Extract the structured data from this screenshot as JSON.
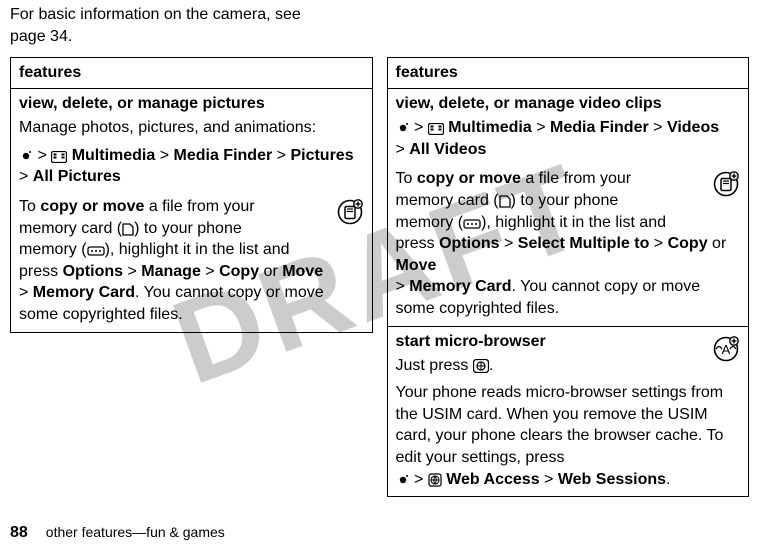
{
  "watermark": "DRAFT",
  "intro": {
    "line1": "For basic information on the camera, see",
    "line2": "page 34."
  },
  "left": {
    "header": "features",
    "row1": {
      "title": "view, delete, or manage pictures",
      "lead": "Manage photos, pictures, and animations:",
      "path1_app": "Multimedia",
      "path1_sep1": ">",
      "path1_b": "Media Finder",
      "path1_sep2": ">",
      "path1_c": "Pictures",
      "path1_sep3": ">",
      "path1_d": "All Pictures",
      "copy_lead_a": "To ",
      "copy_bold": "copy or move",
      "copy_lead_b": " a file from your",
      "copy_line2a": "memory card (",
      "copy_line2b": ") to your phone",
      "copy_line3a": "memory (",
      "copy_line3b": "), highlight it in the list and",
      "copy_line4a": "press ",
      "opt": "Options",
      "sep": ">",
      "manage": "Manage",
      "copy": "Copy",
      "or": " or ",
      "move": "Move",
      "memcard": "Memory Card",
      "tail": ". You cannot copy or move some copyrighted files."
    }
  },
  "right": {
    "header": "features",
    "row1": {
      "title": "view, delete, or manage video clips",
      "path_app": "Multimedia",
      "path_sep1": ">",
      "path_b": "Media Finder",
      "path_sep2": ">",
      "path_c": "Videos",
      "path_sep3": ">",
      "path_d": "All Videos",
      "copy_lead_a": "To ",
      "copy_bold": "copy or move",
      "copy_lead_b": " a file from your",
      "copy_line2a": "memory card (",
      "copy_line2b": ") to your phone",
      "copy_line3a": "memory (",
      "copy_line3b": "), highlight it in the list and",
      "copy_line4a": "press ",
      "opt": "Options",
      "sep": ">",
      "selmult": "Select Multiple to",
      "copy": "Copy",
      "or": " or ",
      "move": "Move",
      "memcard": "Memory Card",
      "tail": ". You cannot copy or move some copyrighted files."
    },
    "row2": {
      "title": "start micro-browser",
      "just_press": "Just press ",
      "period": ".",
      "para2": "Your phone reads micro-browser settings from the USIM card. When you remove the USIM card, your phone clears the browser cache. To edit your settings, press",
      "path_app": "Web Access",
      "sep": ">",
      "path_b": "Web Sessions",
      "period2": "."
    }
  },
  "footer": {
    "pagenum": "88",
    "text": "other features—fun & games"
  }
}
